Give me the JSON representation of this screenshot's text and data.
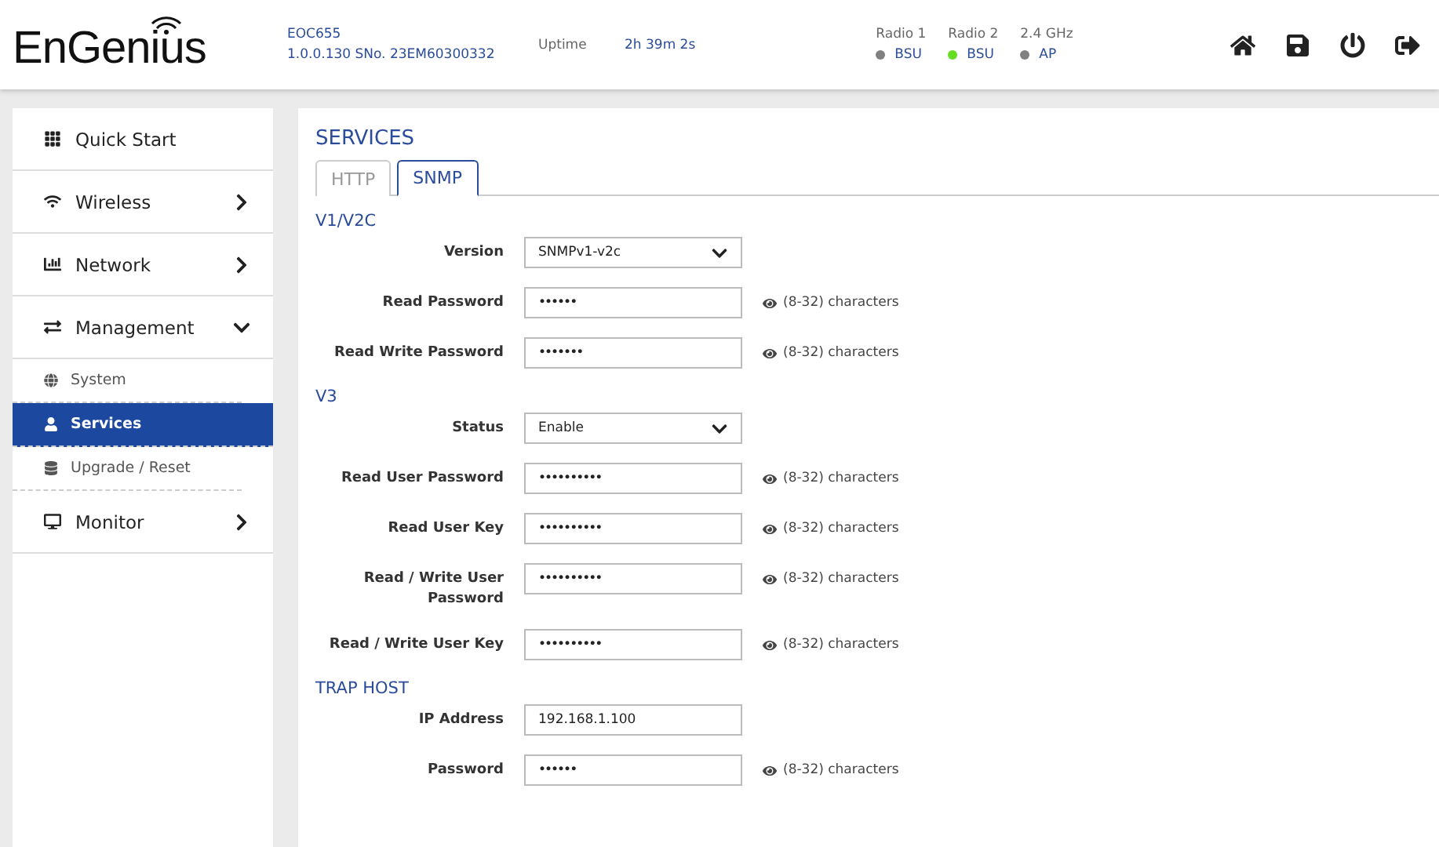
{
  "header": {
    "logo": "EnGenius",
    "model": "EOC655",
    "firmware": "1.0.0.130 SNo. 23EM60300332",
    "uptime_label": "Uptime",
    "uptime": "2h 39m 2s",
    "radios": [
      {
        "label": "Radio 1",
        "mode": "BSU",
        "color": "#808080"
      },
      {
        "label": "Radio 2",
        "mode": "BSU",
        "color": "#66dd22"
      },
      {
        "label": "2.4 GHz",
        "mode": "AP",
        "color": "#808080"
      }
    ]
  },
  "sidebar": {
    "items": [
      {
        "label": "Quick Start"
      },
      {
        "label": "Wireless",
        "expanded": false
      },
      {
        "label": "Network",
        "expanded": false
      },
      {
        "label": "Management",
        "expanded": true,
        "children": [
          {
            "label": "System",
            "selected": false
          },
          {
            "label": "Services",
            "selected": true
          },
          {
            "label": "Upgrade / Reset",
            "selected": false
          }
        ]
      },
      {
        "label": "Monitor",
        "expanded": false
      }
    ]
  },
  "page": {
    "title": "SERVICES",
    "tabs": [
      {
        "label": "HTTP",
        "selected": false
      },
      {
        "label": "SNMP",
        "selected": true
      }
    ],
    "sections": [
      {
        "title": "V1/V2C",
        "fields": [
          {
            "label": "Version",
            "kind": "select",
            "value": "SNMPv1-v2c"
          },
          {
            "label": "Read Password",
            "kind": "password",
            "value": "••••••",
            "hint": "(8-32) characters"
          },
          {
            "label": "Read Write Password",
            "kind": "password",
            "value": "•••••••",
            "hint": "(8-32) characters"
          }
        ]
      },
      {
        "title": "V3",
        "fields": [
          {
            "label": "Status",
            "kind": "select",
            "value": "Enable"
          },
          {
            "label": "Read User Password",
            "kind": "password",
            "value": "••••••••••",
            "hint": "(8-32) characters"
          },
          {
            "label": "Read User Key",
            "kind": "password",
            "value": "••••••••••",
            "hint": "(8-32) characters"
          },
          {
            "label": "Read / Write User Password",
            "kind": "password",
            "value": "••••••••••",
            "hint": "(8-32) characters"
          },
          {
            "label": "Read / Write User Key",
            "kind": "password",
            "value": "••••••••••",
            "hint": "(8-32) characters"
          }
        ]
      },
      {
        "title": "TRAP HOST",
        "fields": [
          {
            "label": "IP Address",
            "kind": "text",
            "value": "192.168.1.100"
          },
          {
            "label": "Password",
            "kind": "password",
            "value": "••••••",
            "hint": "(8-32) characters"
          }
        ]
      }
    ]
  }
}
